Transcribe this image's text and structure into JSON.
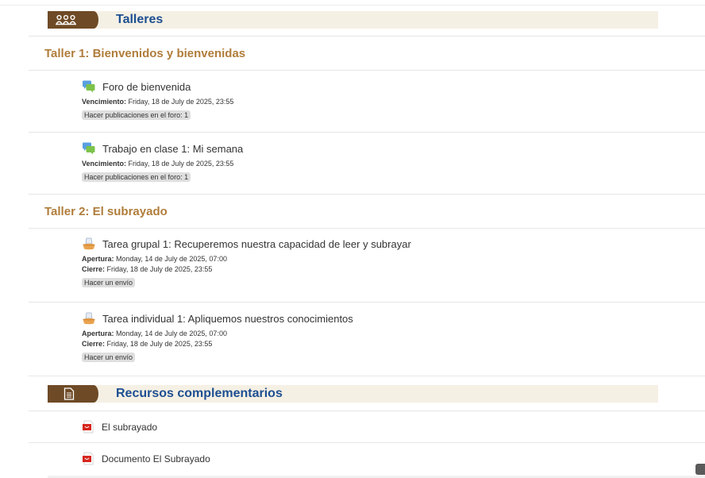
{
  "banners": {
    "talleres": {
      "title": "Talleres",
      "icon": "people-group-icon"
    },
    "recursos": {
      "title": "Recursos complementarios",
      "icon": "document-icon"
    }
  },
  "sections": [
    {
      "title": "Taller 1: Bienvenidos y bienvenidas",
      "activities": [
        {
          "name": "Foro de bienvenida",
          "icon": "forum-icon",
          "dates": [
            {
              "label": "Vencimiento:",
              "value": " Friday, 18 de July de 2025, 23:55"
            }
          ],
          "badge": "Hacer publicaciones en el foro: 1"
        },
        {
          "name": "Trabajo en clase 1: Mi semana",
          "icon": "forum-icon",
          "dates": [
            {
              "label": "Vencimiento:",
              "value": " Friday, 18 de July de 2025, 23:55"
            }
          ],
          "badge": "Hacer publicaciones en el foro: 1"
        }
      ]
    },
    {
      "title": "Taller 2: El subrayado",
      "activities": [
        {
          "name": "Tarea grupal 1: Recuperemos nuestra capacidad de leer y subrayar",
          "icon": "assignment-icon",
          "dates": [
            {
              "label": "Apertura:",
              "value": " Monday, 14 de July de 2025, 07:00"
            },
            {
              "label": "Cierre:",
              "value": " Friday, 18 de July de 2025, 23:55"
            }
          ],
          "badge": "Hacer un envío"
        },
        {
          "name": "Tarea individual 1: Apliquemos nuestros conocimientos",
          "icon": "assignment-icon",
          "dates": [
            {
              "label": "Apertura:",
              "value": " Monday, 14 de July de 2025, 07:00"
            },
            {
              "label": "Cierre:",
              "value": " Friday, 18 de July de 2025, 23:55"
            }
          ],
          "badge": "Hacer un envío"
        }
      ]
    }
  ],
  "resources": [
    {
      "name": "El subrayado",
      "icon": "pdf-icon"
    },
    {
      "name": "Documento El Subrayado",
      "icon": "pdf-icon"
    }
  ],
  "colors": {
    "banner_tab": "#6e4a26",
    "banner_bg": "#f5f0e4",
    "banner_title": "#1d4f91",
    "section_title": "#b07d3b"
  }
}
